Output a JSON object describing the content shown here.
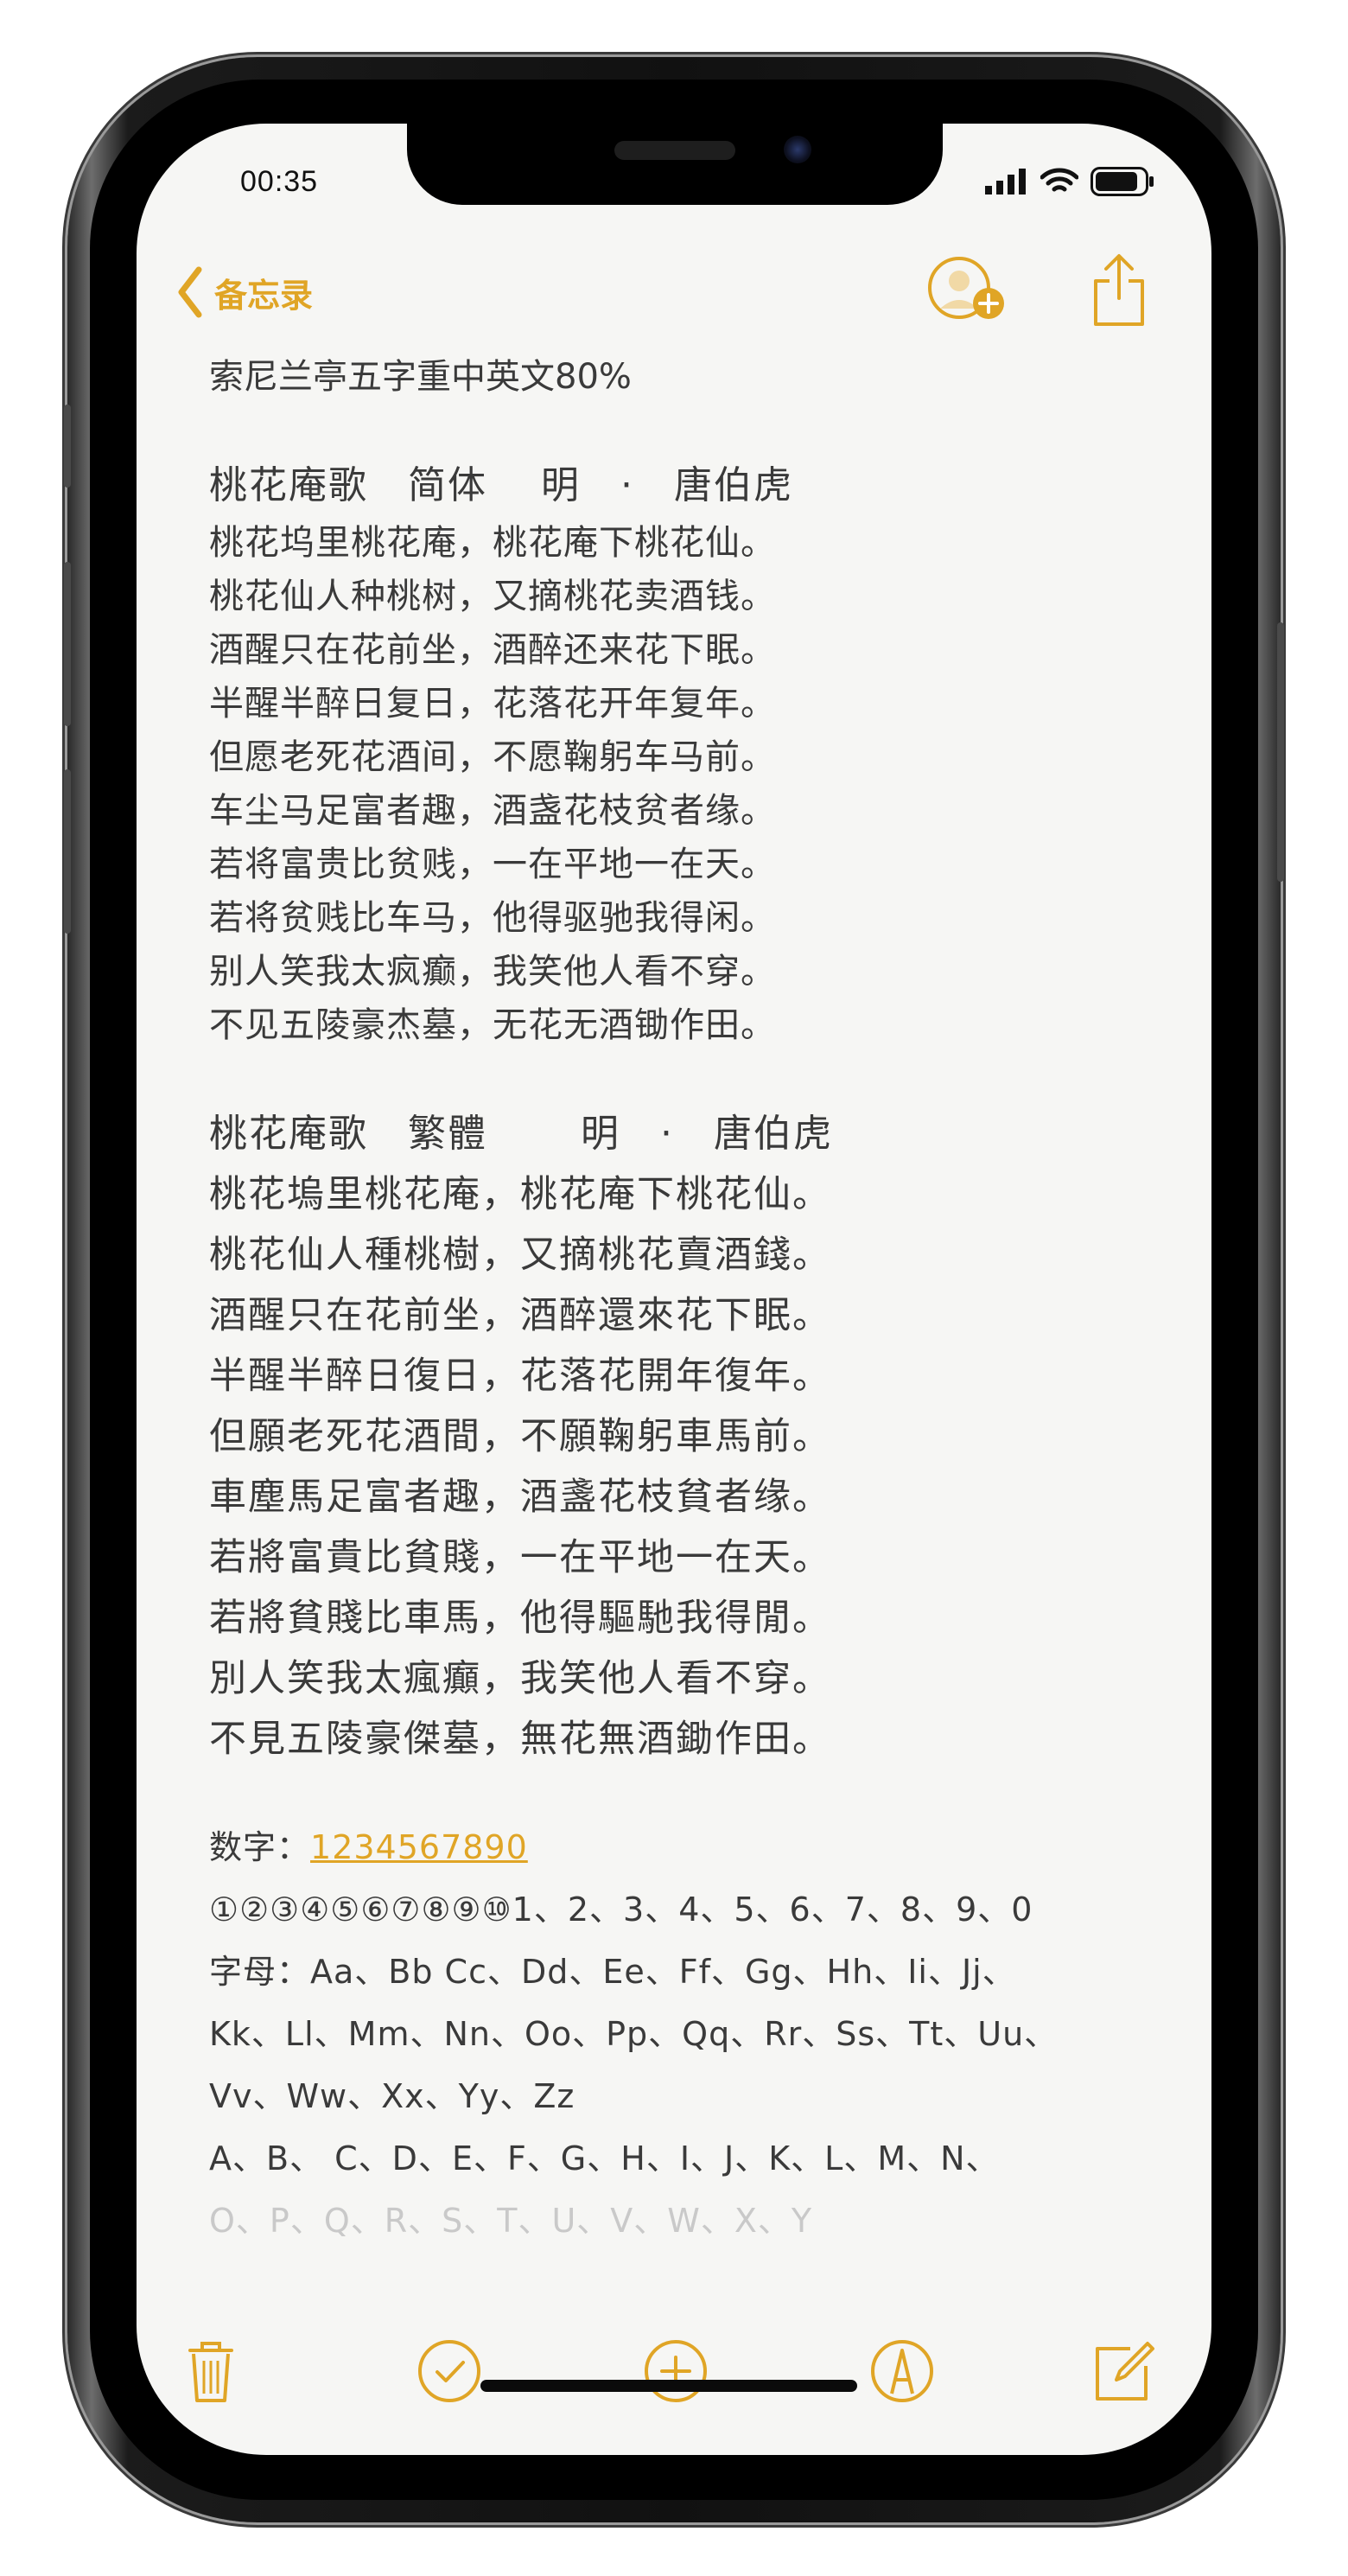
{
  "status_bar": {
    "time": "00:35"
  },
  "nav": {
    "back_label": "备忘录"
  },
  "note": {
    "heading": "索尼兰亭五字重中英文80%",
    "simplified": {
      "title": "桃花庵歌　简体　 明　·　唐伯虎",
      "lines": [
        "桃花坞里桃花庵，桃花庵下桃花仙。",
        "桃花仙人种桃树，又摘桃花卖酒钱。",
        "酒醒只在花前坐，酒醉还来花下眠。",
        "半醒半醉日复日，花落花开年复年。",
        "但愿老死花酒间，不愿鞠躬车马前。",
        "车尘马足富者趣，酒盏花枝贫者缘。",
        "若将富贵比贫贱，一在平地一在天。",
        "若将贫贱比车马，他得驱驰我得闲。",
        "别人笑我太疯癫，我笑他人看不穿。",
        "不见五陵豪杰墓，无花无酒锄作田。"
      ]
    },
    "traditional": {
      "title": "桃花庵歌　繁體　　 明　·　唐伯虎",
      "lines": [
        "桃花塢里桃花庵，桃花庵下桃花仙。",
        "桃花仙人種桃樹，又摘桃花賣酒錢。",
        "酒醒只在花前坐，酒醉還來花下眠。",
        "半醒半醉日復日，花落花開年復年。",
        "但願老死花酒間，不願鞠躬車馬前。",
        "車塵馬足富者趣，酒盞花枝貧者缘。",
        "若將富貴比貧賤，一在平地一在天。",
        "若將貧賤比車馬，他得驅馳我得閒。",
        "別人笑我太瘋癲，我笑他人看不穿。",
        "不見五陵豪傑墓，無花無酒鋤作田。"
      ]
    },
    "numbers_label": "数字：",
    "numbers_link": "1234567890",
    "circled_numbers": "①②③④⑤⑥⑦⑧⑨⑩1、2、3、4、5、6、7、8、9、0",
    "letters_line1": "字母：Aa、Bb Cc、Dd、Ee、Ff、Gg、Hh、Ii、Jj、",
    "letters_line2": "Kk、Ll、Mm、Nn、Oo、Pp、Qq、Rr、Ss、Tt、Uu、",
    "letters_line3": "Vv、Ww、Xx、Yy、Zz",
    "letters_line4": "A、B、 C、D、E、F、G、H、I、J、K、L、M、N、",
    "letters_line5": "O、P、Q、R、S、T、U、V、W、X、Y"
  },
  "colors": {
    "accent": "#e0a526",
    "text": "#3a3a3a",
    "paper": "#f6f6f4"
  },
  "icons": {
    "back": "chevron-left-icon",
    "add_person": "add-person-icon",
    "share": "share-icon",
    "trash": "trash-icon",
    "checklist": "checklist-icon",
    "add": "add-icon",
    "markup": "markup-pen-icon",
    "compose": "compose-icon"
  }
}
